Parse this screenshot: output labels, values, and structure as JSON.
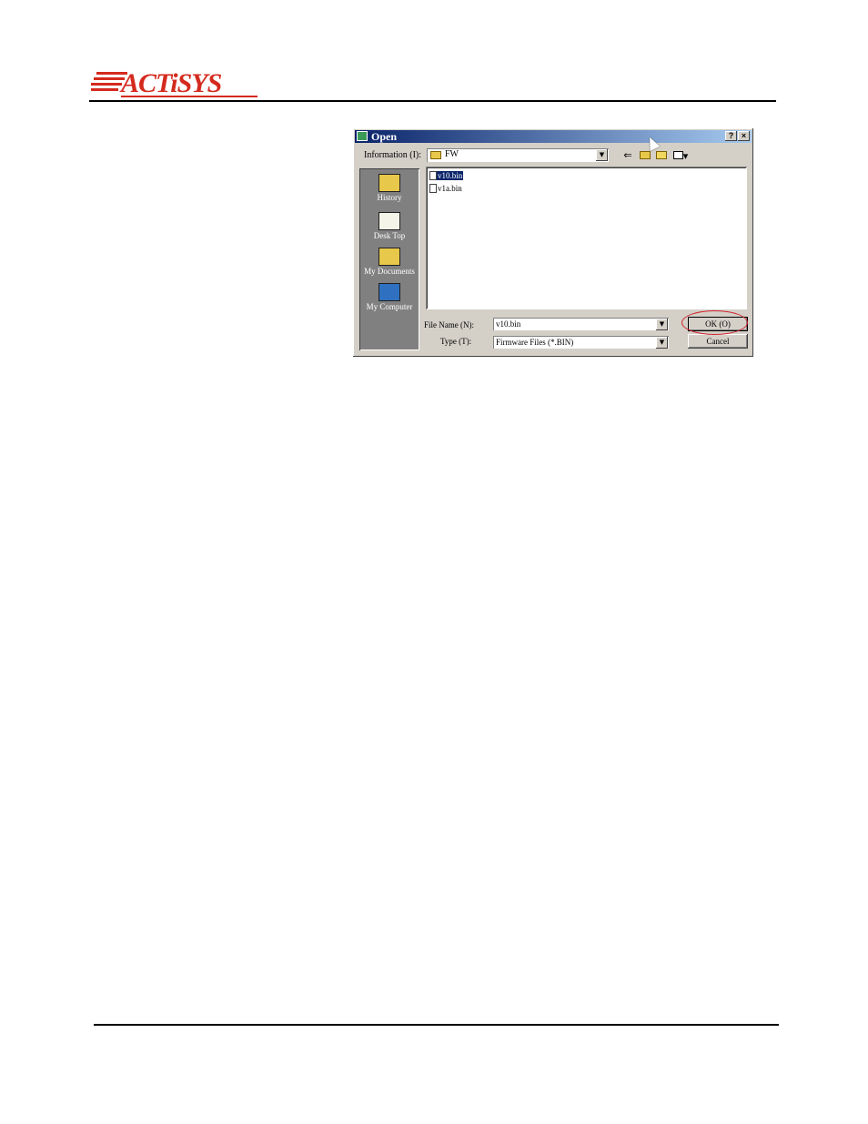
{
  "header": {
    "logo_text": "ACTiSYS"
  },
  "dialog": {
    "title": "Open",
    "help_btn": "?",
    "close_btn": "×",
    "lookin_label": "Information (I):",
    "lookin_value": "FW",
    "toolbar": {
      "back_glyph": "⇐",
      "view_glyph": "▾"
    },
    "places": [
      {
        "label": "History",
        "icon": "history-icon"
      },
      {
        "label": "Desk Top",
        "icon": "desktop-icon"
      },
      {
        "label": "My Documents",
        "icon": "my-documents-icon"
      },
      {
        "label": "My Computer",
        "icon": "my-computer-icon"
      }
    ],
    "files": [
      {
        "name": "v10.bin",
        "selected": true
      },
      {
        "name": "v1a.bin",
        "selected": false
      }
    ],
    "filename_label": "File Name (N):",
    "filename_value": "v10.bin",
    "type_label": "Type (T):",
    "type_value": "Firmware Files (*.BIN)",
    "ok_label": "OK (O)",
    "cancel_label": "Cancel",
    "combo_glyph": "▼",
    "highlight_color": "#d0202a"
  }
}
